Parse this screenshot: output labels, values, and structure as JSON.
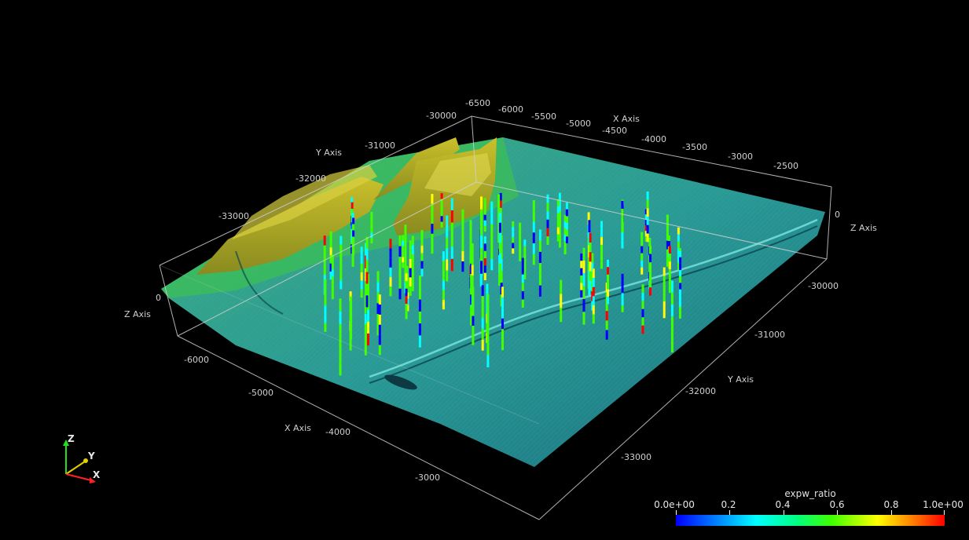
{
  "scene": {
    "x_axis": {
      "title": "X Axis",
      "ticks_top": [
        "-6500",
        "-6000",
        "-5500",
        "-5000",
        "-4500",
        "-4000",
        "-3500",
        "-3000",
        "-2500"
      ],
      "ticks_bottom": [
        "-6000",
        "-5000",
        "-4000",
        "-3000"
      ]
    },
    "y_axis": {
      "title": "Y Axis",
      "ticks_left": [
        "-30000",
        "-31000",
        "-32000",
        "-33000"
      ],
      "ticks_right": [
        "-30000",
        "-31000",
        "-32000",
        "-33000"
      ]
    },
    "z_axis": {
      "title": "Z Axis",
      "tick": "0"
    }
  },
  "colorbar": {
    "title": "expw_ratio",
    "labels": [
      "0.0e+00",
      "0.2",
      "0.4",
      "0.6",
      "0.8",
      "1.0e+00"
    ],
    "colors": [
      "#0000ff",
      "#00ffff",
      "#40ff00",
      "#ffff00",
      "#ff0000"
    ]
  },
  "orientation": {
    "x": "X",
    "y": "Y",
    "z": "Z",
    "x_color": "#ff2020",
    "y_color": "#e0d000",
    "z_color": "#20e020"
  }
}
